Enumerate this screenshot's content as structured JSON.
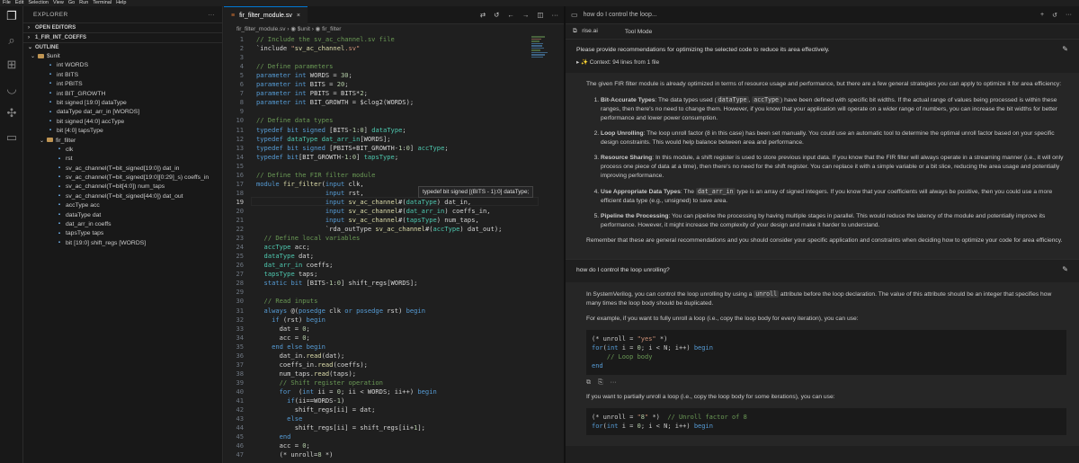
{
  "menu": [
    "File",
    "Edit",
    "Selection",
    "View",
    "Go",
    "Run",
    "Terminal",
    "Help"
  ],
  "activity": [
    {
      "name": "explorer-icon",
      "glyph": "❐"
    },
    {
      "name": "search-icon",
      "glyph": "⌕"
    },
    {
      "name": "extensions-icon",
      "glyph": "⊞"
    },
    {
      "name": "smiley-icon",
      "glyph": "◡"
    },
    {
      "name": "puzzle-icon",
      "glyph": "✣"
    },
    {
      "name": "chat-icon",
      "glyph": "▭"
    }
  ],
  "sidebar": {
    "title": "EXPLORER",
    "more": "···",
    "open_editors": "OPEN EDITORS",
    "folder": "1_FIR_INT_COEFFS",
    "outline": "OUTLINE",
    "outline_items": [
      {
        "label": "$unit",
        "indent": 0,
        "kind": "folder",
        "expanded": true
      },
      {
        "label": "int WORDS",
        "indent": 1,
        "kind": "var"
      },
      {
        "label": "int BITS",
        "indent": 1,
        "kind": "var"
      },
      {
        "label": "int PBITS",
        "indent": 1,
        "kind": "var"
      },
      {
        "label": "int BIT_GROWTH",
        "indent": 1,
        "kind": "var"
      },
      {
        "label": "bit signed [19:0] dataType",
        "indent": 1,
        "kind": "var"
      },
      {
        "label": "dataType dat_arr_in [WORDS]",
        "indent": 1,
        "kind": "var"
      },
      {
        "label": "bit signed [44:0] accType",
        "indent": 1,
        "kind": "var"
      },
      {
        "label": "bit [4:0] tapsType",
        "indent": 1,
        "kind": "var"
      },
      {
        "label": "fir_filter",
        "indent": 1,
        "kind": "folder",
        "expanded": true
      },
      {
        "label": "clk",
        "indent": 2,
        "kind": "var"
      },
      {
        "label": "rst",
        "indent": 2,
        "kind": "var"
      },
      {
        "label": "sv_ac_channel(T=bit_signed[19:0]) dat_in",
        "indent": 2,
        "kind": "var"
      },
      {
        "label": "sv_ac_channel(T=bit_signed[19:0][0:29]_s) coeffs_in",
        "indent": 2,
        "kind": "var"
      },
      {
        "label": "sv_ac_channel(T=bit[4:0]) num_taps",
        "indent": 2,
        "kind": "var"
      },
      {
        "label": "sv_ac_channel(T=bit_signed[44:0]) dat_out",
        "indent": 2,
        "kind": "var"
      },
      {
        "label": "accType acc",
        "indent": 2,
        "kind": "var"
      },
      {
        "label": "dataType dat",
        "indent": 2,
        "kind": "var"
      },
      {
        "label": "dat_arr_in coeffs",
        "indent": 2,
        "kind": "var"
      },
      {
        "label": "tapsType taps",
        "indent": 2,
        "kind": "var"
      },
      {
        "label": "bit [19:0] shift_regs [WORDS]",
        "indent": 2,
        "kind": "var"
      }
    ]
  },
  "editor": {
    "tab_label": "fir_filter_module.sv",
    "tab_close": "×",
    "breadcrumb": "fir_filter_module.sv  ›  ◉ $unit  ›  ◉ fir_filter",
    "hover_text": "typedef bit signed [(BITS - 1):0] dataType;",
    "current_line": 19,
    "line_numbers": [
      1,
      2,
      3,
      4,
      5,
      6,
      7,
      8,
      9,
      10,
      11,
      12,
      13,
      14,
      15,
      16,
      17,
      18,
      19,
      20,
      21,
      22,
      23,
      24,
      25,
      26,
      27,
      28,
      29,
      30,
      31,
      32,
      33,
      34,
      35,
      36,
      37,
      38,
      39,
      40,
      41,
      42,
      43,
      44,
      45,
      46,
      47
    ],
    "lines": [
      "// Include the sv_ac_channel.sv file",
      "`include \"sv_ac_channel.sv\"",
      "",
      "// Define parameters",
      "parameter int WORDS = 30;",
      "parameter int BITS = 20;",
      "parameter int PBITS = BITS*2;",
      "parameter int BIT_GROWTH = $clog2(WORDS);",
      "",
      "// Define data types",
      "typedef bit signed [BITS-1:0] dataType;",
      "typedef dataType dat_arr_in[WORDS];",
      "typedef bit signed [PBITS+BIT_GROWTH-1:0] accType;",
      "typedef bit[BIT_GROWTH-1:0] tapsType;",
      "",
      "// Define the FIR filter module",
      "module fir_filter(input clk,",
      "                  input rst,",
      "                  input sv_ac_channel#(dataType) dat_in,",
      "                  input sv_ac_channel#(dat_arr_in) coeffs_in,",
      "                  input sv_ac_channel#(tapsType) num_taps,",
      "                  `rda_outType sv_ac_channel#(accType) dat_out);",
      "  // Define local variables",
      "  accType acc;",
      "  dataType dat;",
      "  dat_arr_in coeffs;",
      "  tapsType taps;",
      "  static bit [BITS-1:0] shift_regs[WORDS];",
      "",
      "  // Read inputs",
      "  always @(posedge clk or posedge rst) begin",
      "    if (rst) begin",
      "      dat = 0;",
      "      acc = 0;",
      "    end else begin",
      "      dat_in.read(dat);",
      "      coeffs_in.read(coeffs);",
      "      num_taps.read(taps);",
      "      // Shift register operation",
      "      for  (int ii = 0; ii < WORDS; ii++) begin",
      "        if(ii==WORDS-1)",
      "          shift_regs[ii] = dat;",
      "        else",
      "          shift_regs[ii] = shift_regs[ii+1];",
      "      end",
      "      acc = 0;",
      "      (* unroll=8 *)"
    ]
  },
  "chat": {
    "tab_title": "how do I control the loop...",
    "tab_more": "···",
    "sub_left": "rise.ai",
    "sub_right": "Tool Mode",
    "q1": "Please provide recommendations for optimizing the selected code to reduce its area effectively.",
    "context": "▸ ✨ Context: 94 lines from 1 file",
    "a1_intro": "The given FIR filter module is already optimized in terms of resource usage and performance, but there are a few general strategies you can apply to optimize it for area efficiency:",
    "a1_items": [
      {
        "title": "Bit-Accurate Types",
        "pre": ": The data types used (",
        "code1": "dataType",
        "mid": ", ",
        "code2": "accType",
        "post": ") have been defined with specific bit widths. If the actual range of values being processed is within these ranges, then there's no need to change them. However, if you know that your application will operate on a wider range of numbers, you can increase the bit widths for better performance and lower power consumption."
      },
      {
        "title": "Loop Unrolling",
        "pre": ": The loop unroll factor (8 in this case) has been set manually. You could use an automatic tool to determine the optimal unroll factor based on your specific design constraints. This would help balance between area and performance.",
        "code1": "",
        "mid": "",
        "code2": "",
        "post": ""
      },
      {
        "title": "Resource Sharing",
        "pre": ": In this module, a shift register is used to store previous input data. If you know that the FIR filter will always operate in a streaming manner (i.e., it will only process one piece of data at a time), then there's no need for the shift register. You can replace it with a simple variable or a bit slice, reducing the area usage and potentially improving performance.",
        "code1": "",
        "mid": "",
        "code2": "",
        "post": ""
      },
      {
        "title": "Use Appropriate Data Types",
        "pre": ": The ",
        "code1": "dat_arr_in",
        "mid": " type is an array of signed integers. If you know that your coefficients will always be positive, then you could use a more efficient data type (e.g., unsigned) to save area.",
        "code2": "",
        "post": ""
      },
      {
        "title": "Pipeline the Processing",
        "pre": ": You can pipeline the processing by having multiple stages in parallel. This would reduce the latency of the module and potentially improve its performance. However, it might increase the complexity of your design and make it harder to understand.",
        "code1": "",
        "mid": "",
        "code2": "",
        "post": ""
      }
    ],
    "a1_outro": "Remember that these are general recommendations and you should consider your specific application and constraints when deciding how to optimize your code for area efficiency.",
    "q2": "how do I control the loop unrolling?",
    "a2_p1_pre": "In SystemVerilog, you can control the loop unrolling by using a ",
    "a2_p1_code": "unroll",
    "a2_p1_post": " attribute before the loop declaration. The value of this attribute should be an integer that specifies how many times the loop body should be duplicated.",
    "a2_p2": "For example, if you want to fully unroll a loop (i.e., copy the loop body for every iteration), you can use:",
    "code1": [
      "(* unroll = \"yes\" *)",
      "for(int i = 0; i < N; i++) begin",
      "    // Loop body",
      "end"
    ],
    "a2_p3": "If you want to partially unroll a loop (i.e., copy the loop body for some iterations), you can use:",
    "code2": [
      "(* unroll = \"8\" *)  // Unroll factor of 8",
      "for(int i = 0; i < N; i++) begin"
    ]
  }
}
